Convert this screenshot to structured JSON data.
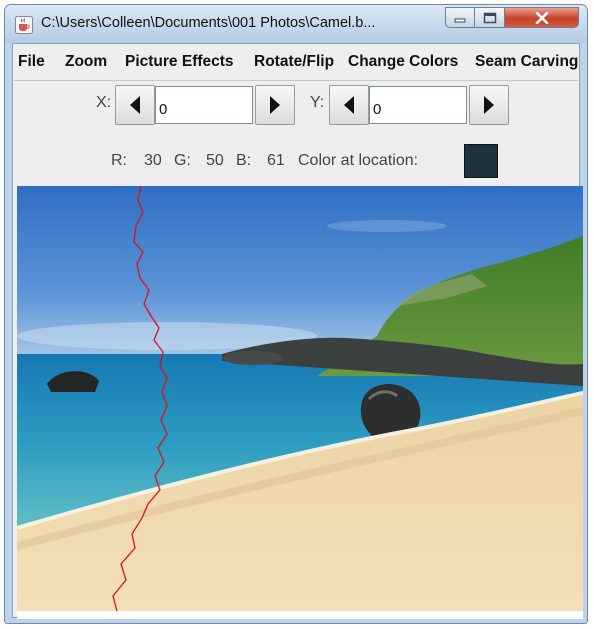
{
  "window": {
    "title": "C:\\Users\\Colleen\\Documents\\001 Photos\\Camel.b..."
  },
  "menu": {
    "items": [
      "File",
      "Zoom",
      "Picture Effects",
      "Rotate/Flip",
      "Change Colors",
      "Seam Carving"
    ]
  },
  "coords": {
    "x_label": "X:",
    "x_value": "0",
    "y_label": "Y:",
    "y_value": "0"
  },
  "color_info": {
    "r_label": "R:",
    "r_value": "30",
    "g_label": "G:",
    "g_value": "50",
    "b_label": "B:",
    "b_value": "61",
    "location_label": "Color at location:",
    "swatch_color": "#1e323d"
  },
  "icons": {
    "app": "java-cup-icon",
    "minimize": "minimize-icon",
    "maximize": "maximize-icon",
    "close": "close-icon",
    "left": "left-arrow-icon",
    "right": "right-arrow-icon"
  },
  "colors": {
    "seam_line": "#d8141a"
  }
}
